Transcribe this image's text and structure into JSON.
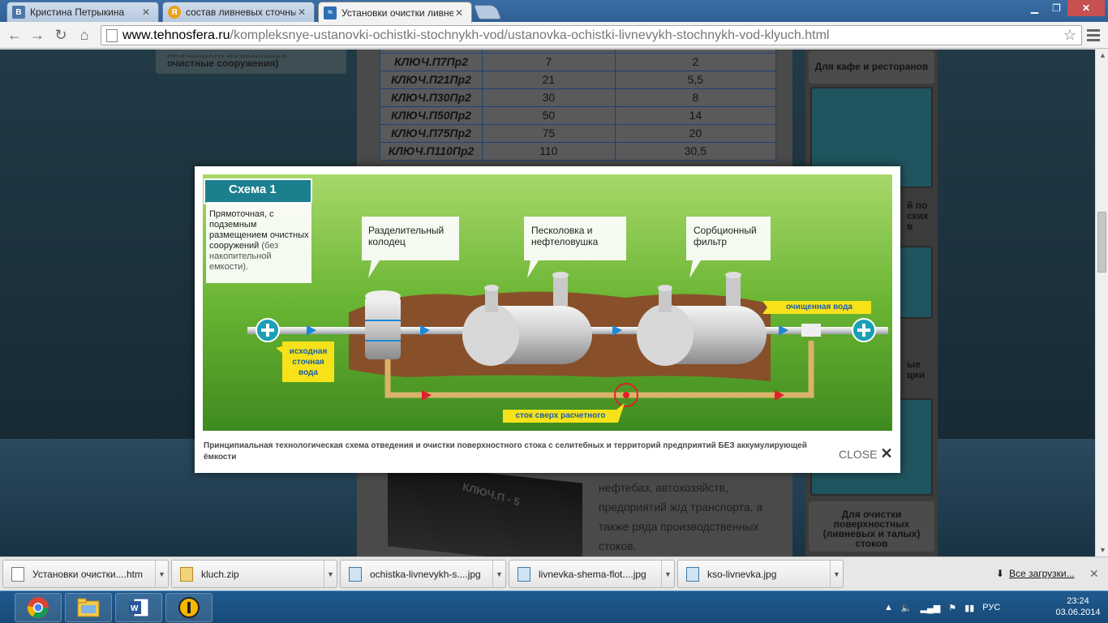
{
  "browser": {
    "tabs": [
      {
        "title": "Кристина Петрыкина",
        "favicon": "В",
        "favicon_color": "#4a76a8",
        "active": false
      },
      {
        "title": "состав ливневых сточны",
        "favicon": "Я",
        "favicon_color": "#e8a21a",
        "active": false
      },
      {
        "title": "Установки очистки ливне",
        "favicon": "≈",
        "favicon_color": "#2d6fb3",
        "active": true
      }
    ],
    "url_host": "www.tehnosfera.ru",
    "url_path": "/kompleksnye-ustanovki-ochistki-stochnykh-vod/ustanovka-ochistki-livnevykh-stochnykh-vod-klyuch.html"
  },
  "page": {
    "left_card_text": "очистные сооружения)",
    "left_card_text_top": "подземного размещения",
    "table_rows": [
      {
        "model": "КЛЮЧ.П7Пр2",
        "v1": "7",
        "v2": "2"
      },
      {
        "model": "КЛЮЧ.П21Пр2",
        "v1": "21",
        "v2": "5,5"
      },
      {
        "model": "КЛЮЧ.П30Пр2",
        "v1": "30",
        "v2": "8"
      },
      {
        "model": "КЛЮЧ.П50Пр2",
        "v1": "50",
        "v2": "14"
      },
      {
        "model": "КЛЮЧ.П75Пр2",
        "v1": "75",
        "v2": "20"
      },
      {
        "model": "КЛЮЧ.П110Пр2",
        "v1": "110",
        "v2": "30,5"
      }
    ],
    "body_text": "нефтебаз, автохозяйств, предприятий ж/д транспорта, а также ряда производственных стоков.",
    "product_label": "КЛЮЧ.П - 5",
    "right_col": {
      "cafe": "Для кафе и ресторанов",
      "frag1": "й по\nских\nв",
      "frag2": "ые\nции",
      "surface": "Для очистки поверхностных (ливневых и талых) стоков"
    }
  },
  "modal": {
    "scheme": {
      "title": "Схема 1",
      "desc_main": "Прямоточная, с подземным размещением очистных сооружений",
      "desc_note": "(без накопительной емкости).",
      "node1": "Разделительный колодец",
      "node2": "Песколовка и нефтеловушка",
      "node3": "Сорбционный фильтр",
      "inlet": "исходная сточная вода",
      "outlet": "очищенная вода",
      "overflow": "сток сверх расчетного"
    },
    "caption": "Принципиальная технологическая схема отведения и очистки поверхностного стока с селитебных и территорий предприятий БЕЗ аккумулирующей ёмкости",
    "close_label": "CLOSE"
  },
  "downloads": {
    "items": [
      {
        "name": "Установки очистки....htm",
        "type": "htm"
      },
      {
        "name": "kluch.zip",
        "type": "zip"
      },
      {
        "name": "ochistka-livnevykh-s....jpg",
        "type": "img"
      },
      {
        "name": "livnevka-shema-flot....jpg",
        "type": "img"
      },
      {
        "name": "kso-livnevka.jpg",
        "type": "img"
      }
    ],
    "all_label": "Все загрузки..."
  },
  "taskbar": {
    "lang": "РУС",
    "time": "23:24",
    "date": "03.06.2014"
  },
  "colors": {
    "scheme_teal": "#1c7f8e",
    "scheme_yellow": "#f7e21a",
    "grass": "#5fae2a",
    "soil": "#8a4b2a"
  }
}
